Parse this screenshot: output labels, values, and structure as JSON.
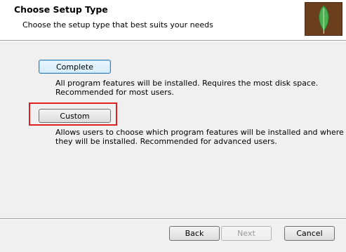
{
  "header": {
    "title": "Choose Setup Type",
    "subtitle": "Choose the setup type that best suits your needs",
    "logo_icon": "mongodb-leaf-icon"
  },
  "options": {
    "complete": {
      "label": "Complete",
      "description_line1": "All program features will be installed. Requires the most disk space.",
      "description_line2": "Recommended for most users."
    },
    "custom": {
      "label": "Custom",
      "description_line1": "Allows users to choose which program features will be installed and where",
      "description_line2": "they will be installed. Recommended for advanced users."
    }
  },
  "footer": {
    "back_label": "Back",
    "next_label": "Next",
    "cancel_label": "Cancel"
  },
  "colors": {
    "highlight": "#e02020",
    "logo_background": "#6b3f1d",
    "leaf_green": "#4caf50"
  }
}
